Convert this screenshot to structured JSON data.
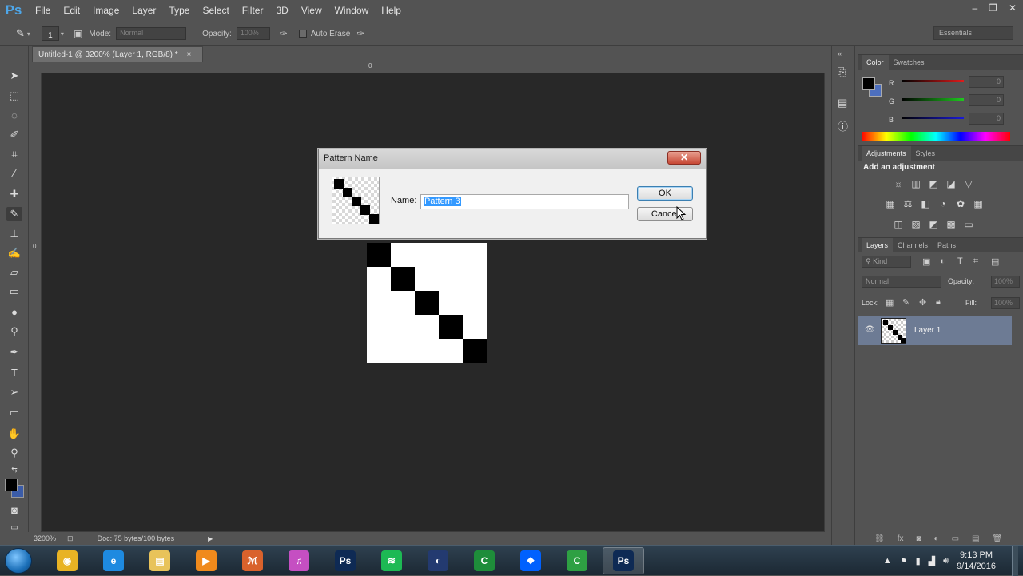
{
  "app": {
    "logo": "Ps"
  },
  "menu": [
    "File",
    "Edit",
    "Image",
    "Layer",
    "Type",
    "Select",
    "Filter",
    "3D",
    "View",
    "Window",
    "Help"
  ],
  "window_controls": [
    "–",
    "❐",
    "✕"
  ],
  "options_bar": {
    "brush_size": "1",
    "mode_label": "Mode:",
    "mode_value": "Normal",
    "opacity_label": "Opacity:",
    "opacity_value": "100%",
    "auto_erase_label": "Auto Erase",
    "workspace": "Essentials"
  },
  "document": {
    "tab_title": "Untitled-1 @ 3200% (Layer 1, RGB/8) *",
    "ruler_top_zero": "0",
    "ruler_left_zero": "0",
    "zoom": "3200%",
    "doc_info": "Doc: 75 bytes/100 bytes"
  },
  "color_panel": {
    "tabs": [
      "Color",
      "Swatches"
    ],
    "channels": [
      {
        "label": "R",
        "value": "0",
        "color": "#e01b1b"
      },
      {
        "label": "G",
        "value": "0",
        "color": "#1fc81f"
      },
      {
        "label": "B",
        "value": "0",
        "color": "#1a1ad8"
      }
    ]
  },
  "adjustments_panel": {
    "tabs": [
      "Adjustments",
      "Styles"
    ],
    "heading": "Add an adjustment"
  },
  "layers_panel": {
    "tabs": [
      "Layers",
      "Channels",
      "Paths"
    ],
    "filter_kind": "Kind",
    "blend_mode": "Normal",
    "opacity_label": "Opacity:",
    "opacity_value": "100%",
    "lock_label": "Lock:",
    "fill_label": "Fill:",
    "fill_value": "100%",
    "layers": [
      {
        "name": "Layer 1"
      }
    ]
  },
  "dialog": {
    "title": "Pattern Name",
    "close": "✕",
    "name_label": "Name:",
    "name_value": "Pattern 3",
    "ok_label": "OK",
    "cancel_label": "Cancel"
  },
  "taskbar": {
    "apps": [
      {
        "icon": "chrome-icon",
        "color": "#e8b324",
        "glyph": "◉"
      },
      {
        "icon": "internet-explorer-icon",
        "color": "#1e8ae0",
        "glyph": "e"
      },
      {
        "icon": "file-explorer-icon",
        "color": "#e8c35a",
        "glyph": "▤"
      },
      {
        "icon": "media-player-icon",
        "color": "#f08a1c",
        "glyph": "▶"
      },
      {
        "icon": "mathcad-icon",
        "color": "#d9622c",
        "glyph": "ℳ"
      },
      {
        "icon": "itunes-icon",
        "color": "#c54fc2",
        "glyph": "♫"
      },
      {
        "icon": "photoshop-icon",
        "color": "#0e2a54",
        "glyph": "Ps"
      },
      {
        "icon": "spotify-icon",
        "color": "#1db954",
        "glyph": "≋"
      },
      {
        "icon": "cinema4d-icon",
        "color": "#233a70",
        "glyph": "◐"
      },
      {
        "icon": "camtasia-icon",
        "color": "#1e8d3a",
        "glyph": "C"
      },
      {
        "icon": "dropbox-icon",
        "color": "#0061fe",
        "glyph": "❖"
      },
      {
        "icon": "camtasia-recorder-icon",
        "color": "#2ea043",
        "glyph": "C"
      },
      {
        "icon": "photoshop-active-icon",
        "color": "#0e2a54",
        "glyph": "Ps"
      }
    ],
    "time": "9:13 PM",
    "date": "9/14/2016"
  }
}
